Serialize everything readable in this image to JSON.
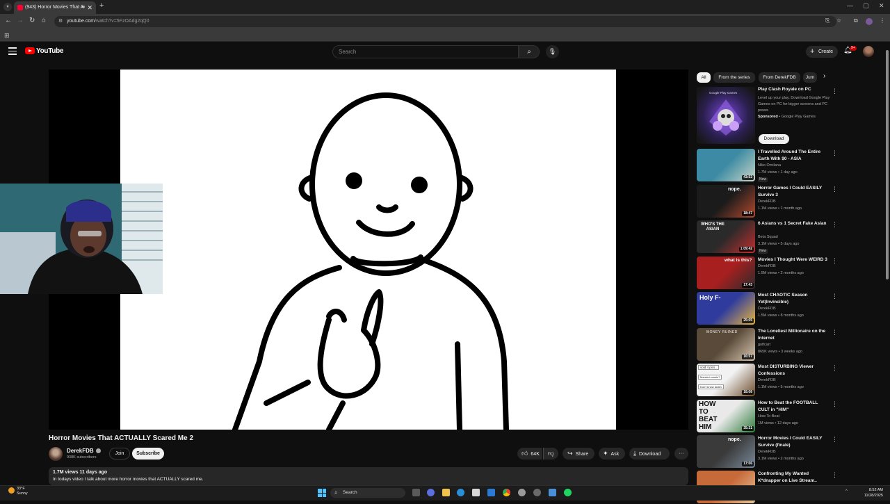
{
  "browser": {
    "tab_title": "(943) Horror Movies That A",
    "url_host": "youtube.com",
    "url_path": "/watch?v=5FzOAdg2qQ0",
    "new_tab": "+"
  },
  "header": {
    "logo_text": "YouTube",
    "search_placeholder": "Search",
    "create_label": "Create",
    "notification_count": "9+"
  },
  "video": {
    "title": "Horror Movies That ACTUALLY Scared Me 2",
    "channel": "DerekFDB",
    "subscribers": "938K subscribers",
    "join_label": "Join",
    "subscribe_label": "Subscribe",
    "likes": "64K",
    "share_label": "Share",
    "ask_label": "Ask",
    "download_label": "Download",
    "more_label": "···",
    "views_date": "1.7M views  11 days ago",
    "description": "In todays video I talk about more horror movies that ACTUALLY scared me."
  },
  "sidebar": {
    "chips": [
      {
        "label": "All",
        "active": true
      },
      {
        "label": "From the series",
        "active": false
      },
      {
        "label": "From DerekFDB",
        "active": false
      },
      {
        "label": "Jum",
        "active": false
      }
    ],
    "ad": {
      "title": "Play Clash Royale on PC",
      "description": "Level up your play. Download Google Play Games on PC for bigger screens and PC power.",
      "sponsored": "Sponsored",
      "advertiser": " • Google Play Games",
      "thumb_caption": "Google Play Games",
      "button": "Download"
    },
    "recommendations": [
      {
        "title": "I Travelled Around The Entire Earth With $0 - ASIA",
        "channel": "Niko Omilana",
        "meta": "1.7M views • 1 day ago",
        "badge": "New",
        "duration": "43:53",
        "colors": [
          "#3c8aa3",
          "#c9d6c8"
        ]
      },
      {
        "title": "Horror Games I Could EASILY Survive 3",
        "channel": "DerekFDB",
        "meta": "1.1M views • 1 month ago",
        "badge": "",
        "duration": "18:47",
        "colors": [
          "#1b1b1b",
          "#b54a2f"
        ]
      },
      {
        "title": "6 Asians vs 1 Secret Fake Asian",
        "channel": "Beta Squad",
        "meta": "3.1M views • 5 days ago",
        "badge": "New",
        "duration": "1:09:42",
        "colors": [
          "#2a2a2a",
          "#c22e2e"
        ]
      },
      {
        "title": "Movies I Thought Were WEIRD 3",
        "channel": "DerekFDB",
        "meta": "1.5M views • 2 months ago",
        "badge": "",
        "duration": "17:43",
        "colors": [
          "#a81f1f",
          "#2b2b2b"
        ]
      },
      {
        "title": "Most CHAOTIC Season Yet(Invincible)",
        "channel": "DerekFDB",
        "meta": "1.5M views • 8 months ago",
        "badge": "",
        "duration": "25:05",
        "colors": [
          "#2f3c9e",
          "#e8b640"
        ]
      },
      {
        "title": "The Loneliest Millionaire on the Internet",
        "channel": "golfcart",
        "meta": "865K views • 3 weeks ago",
        "badge": "",
        "duration": "16:57",
        "colors": [
          "#5a4a3a",
          "#d8c8b0"
        ]
      },
      {
        "title": "Most DISTURBING Viewer Confessions",
        "channel": "DerekFDB",
        "meta": "1.1M views • 5 months ago",
        "badge": "",
        "duration": "18:08",
        "colors": [
          "#f2f2f2",
          "#6b4a2a"
        ]
      },
      {
        "title": "How to Beat the FOOTBALL CULT in \"HIM\"",
        "channel": "How To Beat",
        "meta": "1M views • 12 days ago",
        "badge": "",
        "duration": "35:31",
        "colors": [
          "#e9e9e9",
          "#2e7b3a"
        ]
      },
      {
        "title": "Horror Movies I Could EASILY Survive (finale)",
        "channel": "DerekFDB",
        "meta": "3.1M views • 2 months ago",
        "badge": "",
        "duration": "17:06",
        "colors": [
          "#3a3a3a",
          "#7a8a9a"
        ]
      },
      {
        "title": "Confronting My Wanted K*dnapper on Live Stream..",
        "channel": "",
        "meta": "",
        "badge": "",
        "duration": "",
        "colors": [
          "#c76a3a",
          "#e5c59a"
        ]
      }
    ],
    "thumb_texts": {
      "r1": "nope.",
      "r2": "WHO'S THE ASIAN",
      "r3": "what is this?",
      "r4": "Holy F-",
      "r5": "MONEY RUINED",
      "r6a": "sold 4 pics..",
      "r6b": "Married cousin?",
      "r6c": "Don't know death",
      "r7": "HOW TO BEAT HIM",
      "r8": "nope."
    }
  },
  "taskbar": {
    "temperature": "33°F",
    "weather": "Sunny",
    "search_label": "Search",
    "time": "8:52 AM",
    "date": "11/28/2025"
  }
}
